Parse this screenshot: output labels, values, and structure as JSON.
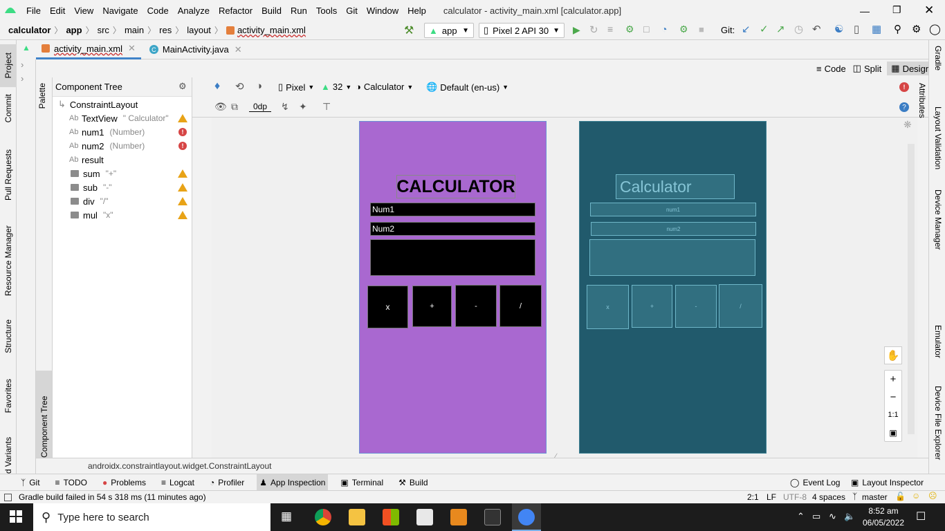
{
  "menu": {
    "items": [
      "File",
      "Edit",
      "View",
      "Navigate",
      "Code",
      "Analyze",
      "Refactor",
      "Build",
      "Run",
      "Tools",
      "Git",
      "Window",
      "Help"
    ],
    "title": "calculator - activity_main.xml [calculator.app]"
  },
  "nav": {
    "crumbs": [
      "calculator",
      "app",
      "src",
      "main",
      "res",
      "layout",
      "activity_main.xml"
    ],
    "run_config": "app",
    "device": "Pixel 2 API 30",
    "git_label": "Git:"
  },
  "tabs": [
    {
      "label": "activity_main.xml"
    },
    {
      "label": "MainActivity.java"
    }
  ],
  "modes": {
    "code": "Code",
    "split": "Split",
    "design": "Design"
  },
  "left_stripe": [
    "Project",
    "Commit",
    "Pull Requests",
    "Resource Manager",
    "Structure",
    "Favorites",
    "d Variants"
  ],
  "right_stripe": [
    "Gradle",
    "Attributes",
    "Layout Validation",
    "Device Manager",
    "Emulator",
    "Device File Explorer"
  ],
  "palette": {
    "palette_label": "Palette",
    "component_tree_label": "Component Tree"
  },
  "tree": {
    "title": "Component Tree",
    "root": "ConstraintLayout",
    "items": [
      {
        "name": "TextView",
        "hint": "\" Calculator\"",
        "status": "warn",
        "kind": "text"
      },
      {
        "name": "num1",
        "hint": "(Number)",
        "status": "error",
        "kind": "text"
      },
      {
        "name": "num2",
        "hint": "(Number)",
        "status": "error",
        "kind": "text"
      },
      {
        "name": "result",
        "hint": "",
        "status": "",
        "kind": "text"
      },
      {
        "name": "sum",
        "hint": "\"+\"",
        "status": "warn",
        "kind": "button"
      },
      {
        "name": "sub",
        "hint": "\"-\"",
        "status": "warn",
        "kind": "button"
      },
      {
        "name": "div",
        "hint": "\"/\"",
        "status": "warn",
        "kind": "button"
      },
      {
        "name": "mul",
        "hint": "\"x\"",
        "status": "warn",
        "kind": "button"
      }
    ]
  },
  "design_toolbar": {
    "device": "Pixel",
    "api": "32",
    "theme": "Calculator",
    "locale": "Default (en-us)",
    "margin": "0dp"
  },
  "design_preview": {
    "title": "CALCULATOR",
    "num1": "Num1",
    "num2": "Num2",
    "buttons": [
      "x",
      "+",
      "-",
      "/"
    ]
  },
  "blueprint_preview": {
    "title": "Calculator",
    "num1": "num1",
    "num2": "num2",
    "buttons": [
      "x",
      "+",
      "-",
      "/"
    ]
  },
  "zoom": {
    "one_to_one": "1:1"
  },
  "path_bar": "androidx.constraintlayout.widget.ConstraintLayout",
  "tool_windows": [
    "Git",
    "TODO",
    "Problems",
    "Logcat",
    "Profiler",
    "App Inspection",
    "Terminal",
    "Build"
  ],
  "tool_windows_right": [
    "Event Log",
    "Layout Inspector"
  ],
  "status": {
    "message": "Gradle build failed in 54 s 318 ms (11 minutes ago)",
    "position": "2:1",
    "line_sep": "LF",
    "encoding": "UTF-8",
    "indent": "4 spaces",
    "branch": "master"
  },
  "taskbar": {
    "search_placeholder": "Type here to search",
    "time": "8:52 am",
    "date": "06/05/2022"
  },
  "colors": {
    "design_bg": "#a968d0",
    "blueprint_bg": "#215a6c",
    "accent": "#4083c9"
  }
}
